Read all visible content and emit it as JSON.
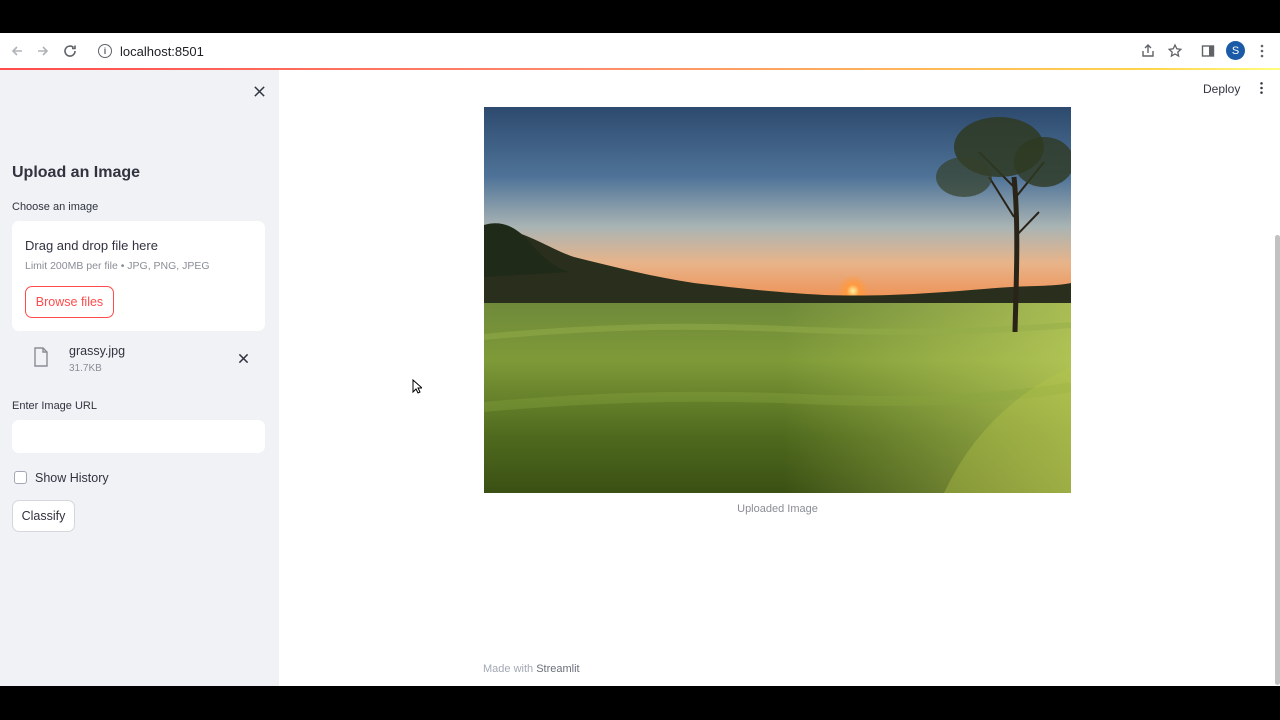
{
  "browser": {
    "url": "localhost:8501",
    "profile_initial": "S"
  },
  "sidebar": {
    "title": "Upload an Image",
    "uploader_label": "Choose an image",
    "dropzone_title": "Drag and drop file here",
    "dropzone_limit": "Limit 200MB per file • JPG, PNG, JPEG",
    "browse_label": "Browse files",
    "uploaded_file": {
      "name": "grassy.jpg",
      "size": "31.7KB"
    },
    "url_label": "Enter Image URL",
    "url_value": "",
    "show_history_label": "Show History",
    "show_history_checked": false,
    "classify_label": "Classify"
  },
  "main": {
    "deploy_label": "Deploy",
    "image_caption": "Uploaded Image",
    "footer_prefix": "Made with",
    "footer_brand": "Streamlit"
  },
  "colors": {
    "accent": "#ff4b4b",
    "sidebar_bg": "#f0f2f6",
    "text": "#31333f"
  }
}
